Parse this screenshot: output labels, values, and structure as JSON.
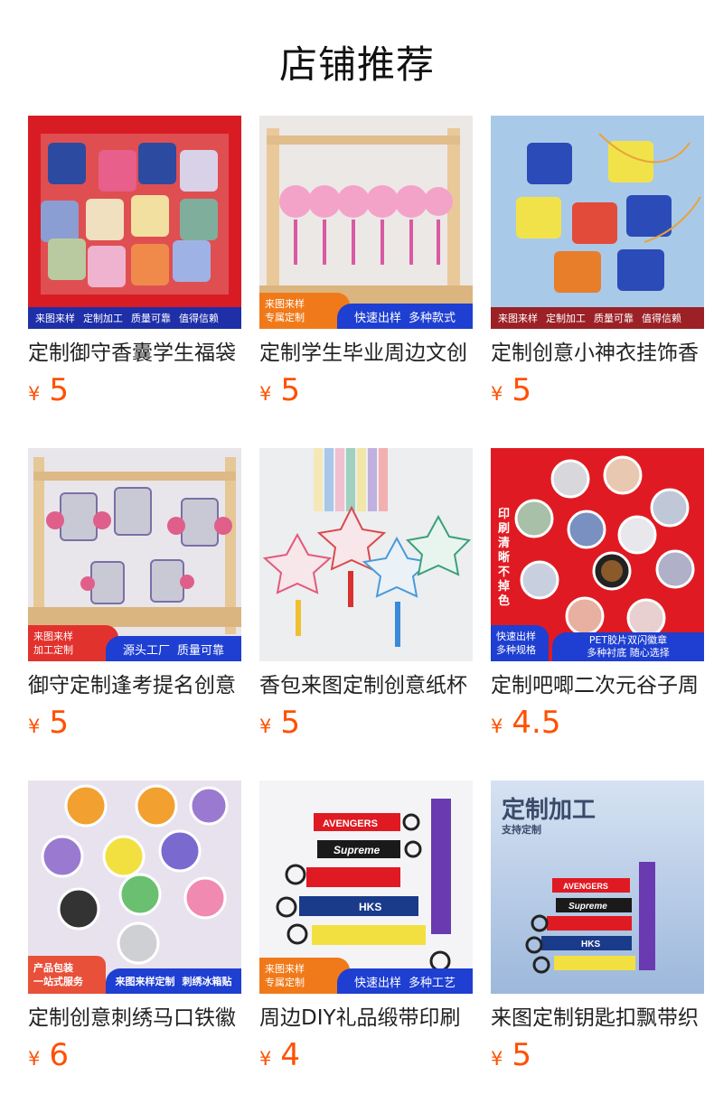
{
  "section_title": "店铺推荐",
  "currency": "¥",
  "products": [
    {
      "name": "定制御守香囊学生福袋",
      "price": "5",
      "banner": [
        "来图来样",
        "定制加工",
        "质量可靠",
        "值得信赖"
      ]
    },
    {
      "name": "定制学生毕业周边文创",
      "price": "5",
      "badge": [
        "来图来样",
        "专属定制"
      ],
      "bar": [
        "快速出样",
        "多种款式"
      ]
    },
    {
      "name": "定制创意小神衣挂饰香",
      "price": "5",
      "banner": [
        "来图来样",
        "定制加工",
        "质量可靠",
        "值得信赖"
      ]
    },
    {
      "name": "御守定制逢考提名创意",
      "price": "5",
      "badge": [
        "来图来样",
        "加工定制"
      ],
      "bar": [
        "源头工厂",
        "质量可靠"
      ]
    },
    {
      "name": "香包来图定制创意纸杯",
      "price": "5"
    },
    {
      "name": "定制吧唧二次元谷子周",
      "price": "4.5",
      "side_text": "印刷清晰不掉色",
      "badge": [
        "快速出样",
        "多种规格"
      ],
      "bar": [
        "PET胶片双闪徽章",
        "多种衬底 随心选择"
      ]
    },
    {
      "name": "定制创意刺绣马口铁徽",
      "price": "6",
      "badge": [
        "产品包装",
        "一站式服务"
      ],
      "bar": [
        "来图来样定制",
        "刺绣冰箱贴"
      ]
    },
    {
      "name": "周边DIY礼品缎带印刷",
      "price": "4",
      "badge": [
        "来图来样",
        "专属定制"
      ],
      "bar": [
        "快速出样",
        "多种工艺"
      ],
      "strap_labels": [
        "AVENGERS",
        "Supreme",
        "HKS"
      ]
    },
    {
      "name": "来图定制钥匙扣飘带织",
      "price": "5",
      "headline": "定制加工",
      "subline": "支持定制",
      "strap_labels": [
        "AVENGERS",
        "Supreme",
        "HKS"
      ]
    }
  ],
  "colors": {
    "price": "#ff5000",
    "badge_orange": "#f07a1a",
    "bar_blue": "#1e3fd1",
    "red_bg": "#e01a22"
  }
}
